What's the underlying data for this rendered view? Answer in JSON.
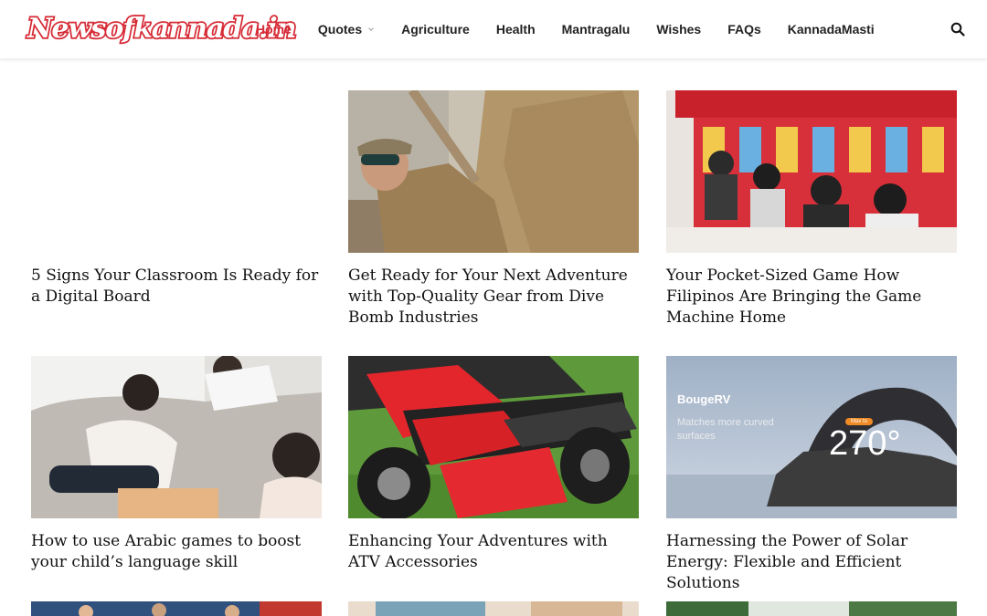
{
  "site": {
    "logo_text": "Newsofkannada.in",
    "accent_color": "#d62b36",
    "logo_icon": "wordmark"
  },
  "nav": {
    "items": [
      {
        "label": "Home",
        "active": true
      },
      {
        "label": "Quotes",
        "has_dropdown": true
      },
      {
        "label": "Agriculture"
      },
      {
        "label": "Health"
      },
      {
        "label": "Mantragalu"
      },
      {
        "label": "Wishes"
      },
      {
        "label": "FAQs"
      },
      {
        "label": "KannadaMasti"
      }
    ],
    "search_icon": "search-icon"
  },
  "articles": [
    {
      "title": "5 Signs Your Classroom Is Ready for a Digital Board",
      "image": "none"
    },
    {
      "title": "Get Ready for Your Next Adventure with Top-Quality Gear from Dive Bomb Industries",
      "image": "man-in-tan-jacket"
    },
    {
      "title": "Your Pocket-Sized Game How Filipinos Are Bringing the Game Machine Home",
      "image": "pachinko-parlor"
    },
    {
      "title": "How to use Arabic games to boost your child’s language skill",
      "image": "children-playing"
    },
    {
      "title": "Enhancing Your Adventures with ATV Accessories",
      "image": "red-atv"
    },
    {
      "title": "Harnessing the Power of Solar Energy: Flexible and Efficient Solutions",
      "image": "solar-panel-ad",
      "image_overlay": {
        "brand": "BougeRV",
        "tagline": "Matches more curved surfaces",
        "badge": "Max to",
        "degrees": "270°"
      }
    }
  ]
}
